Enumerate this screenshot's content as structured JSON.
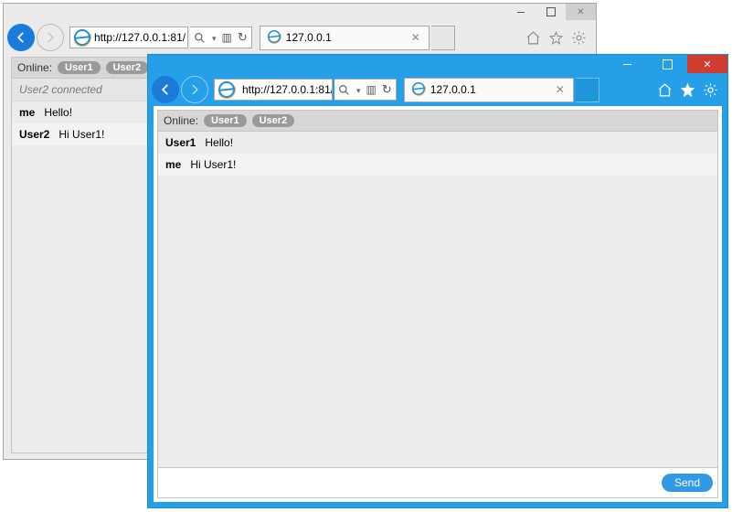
{
  "back": {
    "url": "http://127.0.0.1:81/",
    "tab_title": "127.0.0.1",
    "online_label": "Online:",
    "online_users": [
      "User1",
      "User2"
    ],
    "system_message": "User2 connected",
    "messages": [
      {
        "who": "me",
        "text": "Hello!"
      },
      {
        "who": "User2",
        "text": "Hi User1!"
      }
    ]
  },
  "front": {
    "url": "http://127.0.0.1:81/",
    "tab_title": "127.0.0.1",
    "online_label": "Online:",
    "online_users": [
      "User1",
      "User2"
    ],
    "messages": [
      {
        "who": "User1",
        "text": "Hello!"
      },
      {
        "who": "me",
        "text": "Hi User1!"
      }
    ],
    "input_value": "",
    "send_label": "Send"
  }
}
